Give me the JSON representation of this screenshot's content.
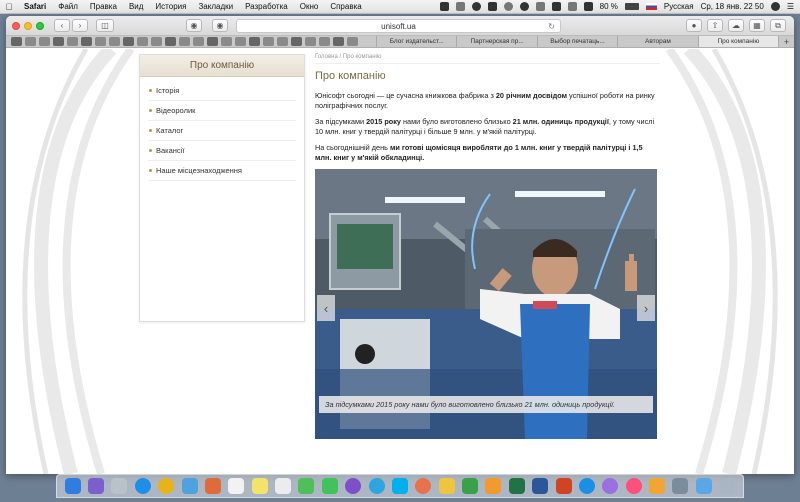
{
  "menubar": {
    "app": "Safari",
    "items": [
      "Файл",
      "Правка",
      "Вид",
      "История",
      "Закладки",
      "Разработка",
      "Окно",
      "Справка"
    ],
    "battery": "80 %",
    "language": "Русская",
    "clock": "Ср, 18 янв. 22 50"
  },
  "browser": {
    "url": "unisoft.ua",
    "tabs": [
      {
        "label": "Блог издательст...",
        "active": false
      },
      {
        "label": "Партнерская пр...",
        "active": false
      },
      {
        "label": "Выбор печатаць...",
        "active": false
      },
      {
        "label": "Авторам",
        "active": false
      },
      {
        "label": "Про компанію",
        "active": true
      }
    ],
    "new_tab": "+"
  },
  "sidebar": {
    "title": "Про компанію",
    "items": [
      "Історія",
      "Відеоролик",
      "Каталог",
      "Вакансії",
      "Наше місцезнаходження"
    ]
  },
  "content": {
    "breadcrumb": "Головна / Про компанію",
    "title": "Про компанію",
    "p1_a": "Юнісофт сьогодні — це сучасна книжкова фабрика з ",
    "p1_b": "20 річним досвідом",
    "p1_c": " успішної роботи на ринку поліграфічних послуг.",
    "p2_a": "За підсумками ",
    "p2_b": "2015 року",
    "p2_c": " нами було виготовлено близько ",
    "p2_d": "21 млн. одиниць продукції",
    "p2_e": ", у тому числі 10 млн. книг у твердій палітурці і більше 9 млн. у м'якій палітурці.",
    "p3_a": "На сьогоднішній день ",
    "p3_b": "ми готові щомісяця виробляти до 1 млн.  книг у твердій палітурці і 1,5 млн. книг у м'якій обкладинці.",
    "slider_caption": "За підсумками 2015 року нами було виготовлено близько 21 млн. одиниць продукції.",
    "prev_arrow": "‹",
    "next_arrow": "›"
  },
  "colors": {
    "accent_title": "#7b6a45",
    "bullet": "#b59a4f",
    "apron": "#2f6fc0"
  }
}
